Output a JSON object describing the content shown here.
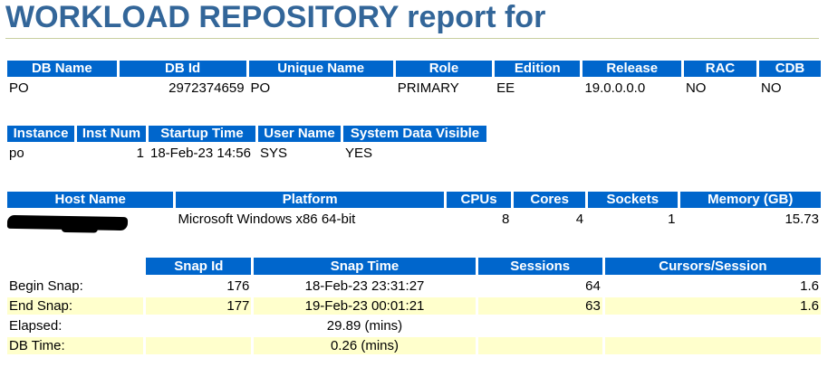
{
  "title": "WORKLOAD REPOSITORY report for",
  "db": {
    "headers": [
      "DB Name",
      "DB Id",
      "Unique Name",
      "Role",
      "Edition",
      "Release",
      "RAC",
      "CDB"
    ],
    "row": [
      "PO",
      "2972374659",
      "PO",
      "PRIMARY",
      "EE",
      "19.0.0.0.0",
      "NO",
      "NO"
    ]
  },
  "instance": {
    "headers": [
      "Instance",
      "Inst Num",
      "Startup Time",
      "User Name",
      "System Data Visible"
    ],
    "row": [
      "po",
      "1",
      "18-Feb-23 14:56",
      "SYS",
      "YES"
    ]
  },
  "host": {
    "headers": [
      "Host Name",
      "Platform",
      "CPUs",
      "Cores",
      "Sockets",
      "Memory (GB)"
    ],
    "row": [
      "",
      "Microsoft Windows x86 64-bit",
      "8",
      "4",
      "1",
      "15.73"
    ]
  },
  "snap": {
    "headers": [
      "",
      "Snap Id",
      "Snap Time",
      "Sessions",
      "Cursors/Session"
    ],
    "rows": [
      [
        "Begin Snap:",
        "176",
        "18-Feb-23 23:31:27",
        "64",
        "1.6"
      ],
      [
        "End Snap:",
        "177",
        "19-Feb-23 00:01:21",
        "63",
        "1.6"
      ],
      [
        "Elapsed:",
        "",
        "29.89 (mins)",
        "",
        ""
      ],
      [
        "DB Time:",
        "",
        "0.26 (mins)",
        "",
        ""
      ]
    ]
  }
}
